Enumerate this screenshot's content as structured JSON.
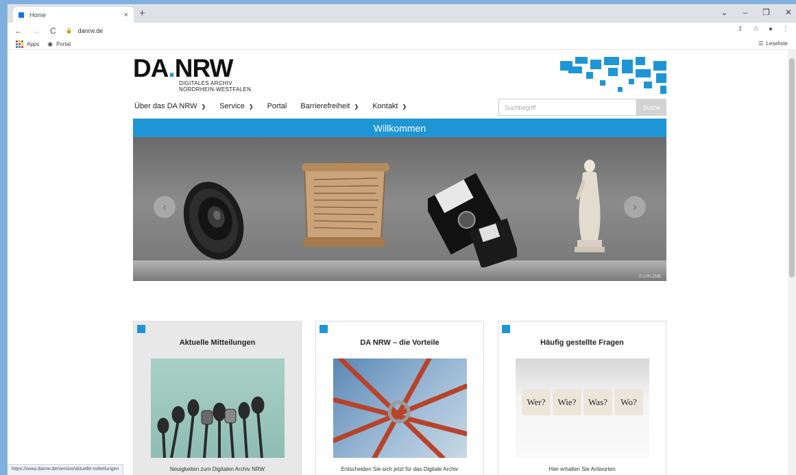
{
  "browser": {
    "tab": {
      "title": "Home",
      "close": "×"
    },
    "new_tab": "+",
    "window_controls": [
      "⌄",
      "–",
      "❐",
      "✕"
    ],
    "nav": {
      "back": "←",
      "forward": "→",
      "reload": "C"
    },
    "address": "danrw.de",
    "toolbar_icons": [
      "⇪",
      "☆",
      "●",
      "⋮"
    ],
    "bookmarks": [
      {
        "label": "Apps",
        "icon": "apps-grid-icon"
      },
      {
        "label": "Portal",
        "icon": "portal-icon"
      }
    ],
    "reading_list": "Leseliste",
    "status_url": "https://www.danrw.de/service/aktuelle-mitteilungen"
  },
  "site": {
    "logo": {
      "main_left": "DA",
      "main_dot": ".",
      "main_right": "NRW",
      "line1": "DIGITALES ARCHIV",
      "line2": "NORDRHEIN-WESTFALEN"
    },
    "nav": [
      {
        "label": "Über das DA NRW",
        "dropdown": true
      },
      {
        "label": "Service",
        "dropdown": true
      },
      {
        "label": "Portal",
        "dropdown": false
      },
      {
        "label": "Barrierefreiheit",
        "dropdown": true
      },
      {
        "label": "Kontakt",
        "dropdown": true
      }
    ],
    "search": {
      "placeholder": "Suchbegriff",
      "button": "Suche"
    },
    "welcome": "Willkommen",
    "slider": {
      "prev": "‹",
      "next": "›",
      "credit": "© LVR-ZMB"
    },
    "cards": [
      {
        "title": "Aktuelle Mitteilungen",
        "desc": "Neuigkeiten zum Digitalen Archiv NRW"
      },
      {
        "title": "DA NRW – die Vorteile",
        "desc": "Entscheiden Sie sich jetzt für das Digitale Archiv"
      },
      {
        "title": "Häufig gestellte Fragen",
        "desc": "Hier erhalten Sie Antworten",
        "words": [
          "Wer?",
          "Wie?",
          "Was?",
          "Wo?"
        ]
      }
    ]
  },
  "colors": {
    "brand_blue": "#1e95d4"
  }
}
